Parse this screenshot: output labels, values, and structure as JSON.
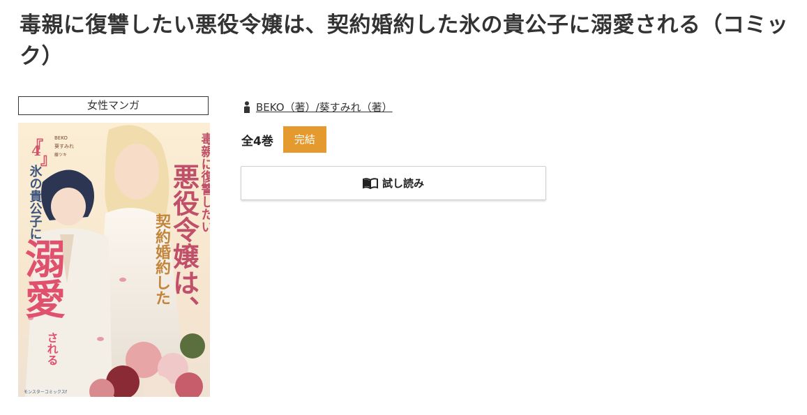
{
  "title": "毒親に復讐したい悪役令嬢は、契約婚約した氷の貴公子に溺愛される（コミック）",
  "genre": "女性マンガ",
  "authors": {
    "icon": "person-icon",
    "text": "BEKO（著）/葵すみれ（著）"
  },
  "volumes": {
    "count_label": "全4巻",
    "status_label": "完結",
    "status_color": "#e49a2f"
  },
  "trial_button": {
    "icon": "open-book-icon",
    "label": "試し読み"
  },
  "cover": {
    "volume_number": "4",
    "title_lines": [
      "毒親に復讐したい",
      "悪役令嬢は、",
      "契約婚約した",
      "氷の貴公子に",
      "溺愛",
      "される"
    ],
    "credits": [
      "BEKO",
      "葵すみれ",
      "藤ツキ"
    ],
    "publisher_logo": "モンスターコミックスf"
  }
}
